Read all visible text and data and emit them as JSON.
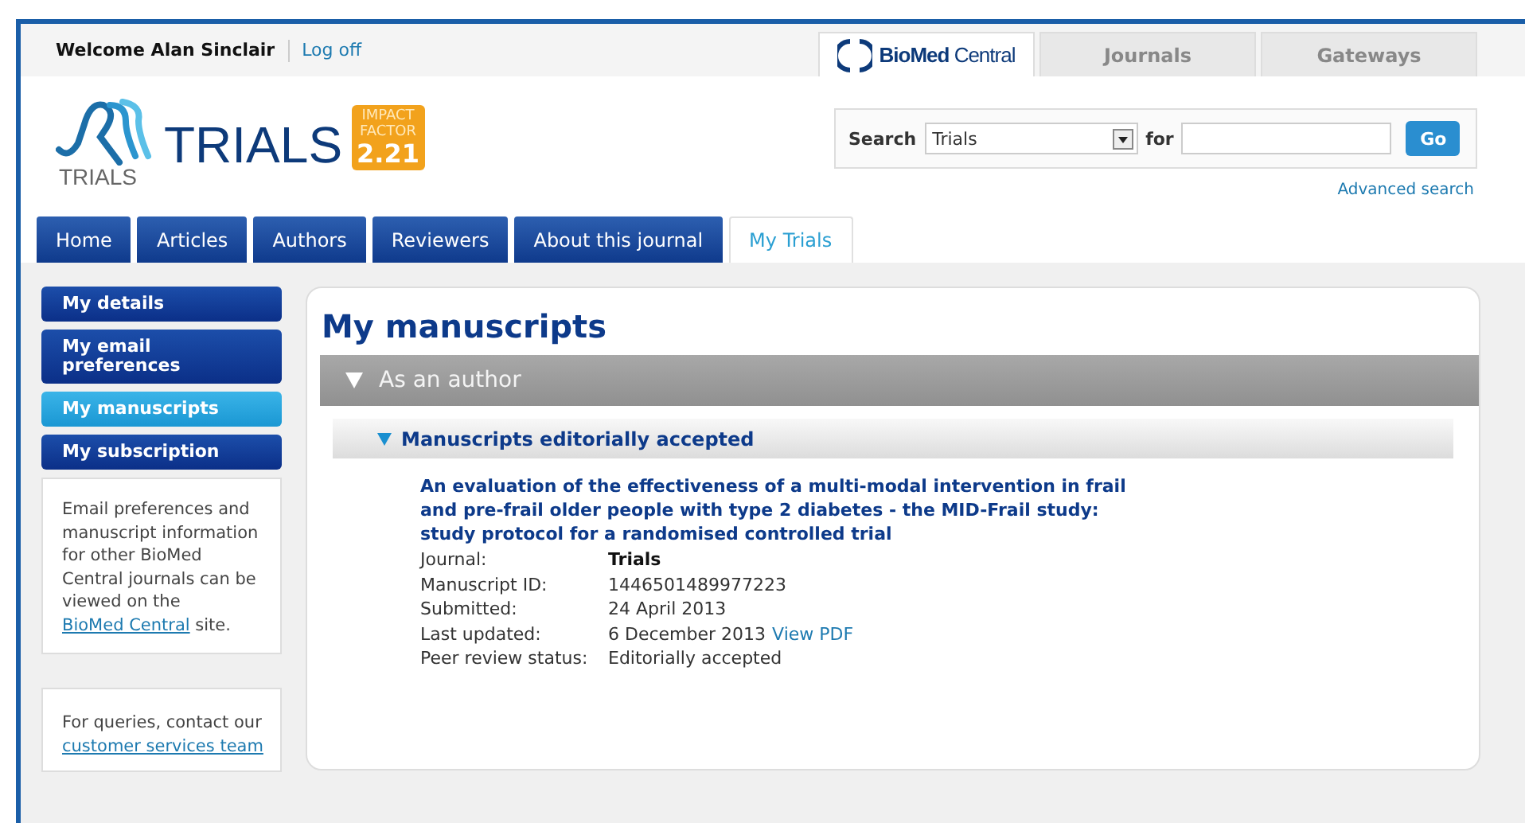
{
  "top_bar": {
    "welcome": "Welcome Alan Sinclair",
    "logoff": "Log off"
  },
  "portal_tabs": [
    {
      "label": "**BioMed** Central",
      "kind": "logo",
      "selected": true
    },
    {
      "label": "Journals",
      "kind": "text",
      "selected": false
    },
    {
      "label": "Gateways",
      "kind": "text",
      "selected": false
    }
  ],
  "logo": {
    "wordmark": "TRIALS",
    "small_text": "TRIALS"
  },
  "impact_badge": {
    "line_1": "IMPACT",
    "line_2": "FACTOR",
    "value": "2.21"
  },
  "search": {
    "label": "Search",
    "scope": "Trials",
    "for_label": "for",
    "button": "Go",
    "advanced_link": "Advanced search"
  },
  "nav_tabs": [
    {
      "label": "Home",
      "selected": false
    },
    {
      "label": "Articles",
      "selected": false
    },
    {
      "label": "Authors",
      "selected": false
    },
    {
      "label": "Reviewers",
      "selected": false
    },
    {
      "label": "About this journal",
      "selected": false
    },
    {
      "label": "My Trials",
      "selected": true
    }
  ],
  "sidebar": {
    "items": [
      {
        "label": "My details",
        "selected": false
      },
      {
        "label": "My email preferences",
        "selected": false
      },
      {
        "label": "My manuscripts",
        "selected": true
      },
      {
        "label": "My subscription",
        "selected": false
      }
    ],
    "notes": [
      {
        "before": "Email preferences and manuscript information for other BioMed Central journals can be viewed on the",
        "link": "BioMed Central",
        "after": "site."
      },
      {
        "before": "For queries, contact our",
        "link": "customer services team"
      }
    ]
  },
  "main": {
    "title": "My manuscripts",
    "section": {
      "label": "As an author",
      "expanded": true,
      "group": {
        "label": "Manuscripts editorially accepted",
        "expanded": true,
        "manuscript": {
          "title": "An evaluation of the effectiveness of a multi-modal intervention in frail and pre-frail older people with type 2 diabetes - the MID-Frail study: study protocol for a randomised controlled trial",
          "fields": [
            {
              "label": "Journal:",
              "value": "Trials",
              "bold": true
            },
            {
              "label": "Manuscript ID:",
              "value": "1446501489977223",
              "bold": false
            },
            {
              "label": "Submitted:",
              "value": "24 April 2013",
              "bold": false
            },
            {
              "label": "Last updated:",
              "value": "6 December 2013",
              "bold": false,
              "link": "View PDF"
            },
            {
              "label": "Peer review status:",
              "value": "Editorially accepted",
              "bold": false
            }
          ]
        }
      }
    }
  }
}
